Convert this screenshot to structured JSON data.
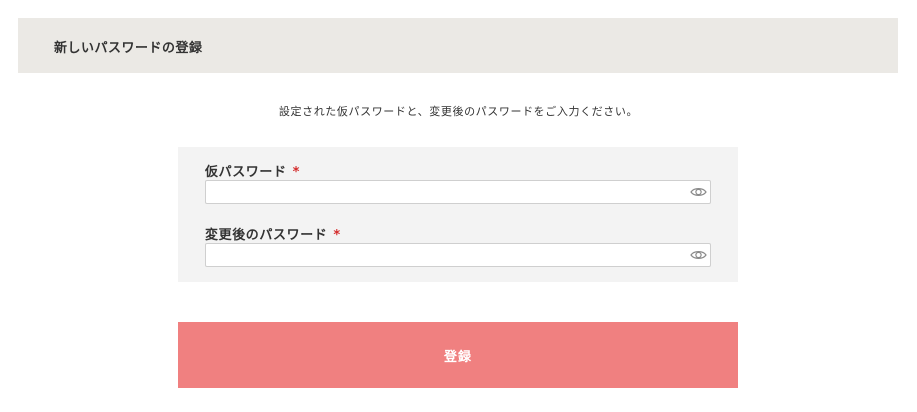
{
  "header": {
    "title": "新しいパスワードの登録"
  },
  "instruction": "設定された仮パスワードと、変更後のパスワードをご入力ください。",
  "form": {
    "fields": [
      {
        "label": "仮パスワード",
        "required_mark": "*",
        "value": "",
        "icon": "eye-icon"
      },
      {
        "label": "変更後のパスワード",
        "required_mark": "*",
        "value": "",
        "icon": "eye-icon"
      }
    ]
  },
  "submit_label": "登録",
  "colors": {
    "header_bg": "#ebe9e5",
    "form_bg": "#f3f3f3",
    "submit_bg": "#f08080",
    "required": "#d42b2b"
  }
}
